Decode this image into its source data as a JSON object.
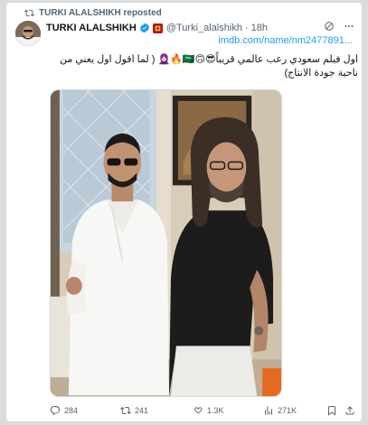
{
  "repost": {
    "label": "TURKI ALALSHIKH reposted"
  },
  "author": {
    "name": "TURKI ALALSHIKH",
    "handle": "@Turki_alalshikh",
    "separator": "·",
    "time": "18h"
  },
  "link": "imdb.com/name/nm2477891...",
  "tweet": {
    "text": "اول فيلم سعودي رعب عالمي قريباً😎🙃🇸🇦🔥🧕🏻 ( لما اقول اول يعني من ناحية جودة الانتاج)"
  },
  "actions": {
    "replies": "284",
    "reposts": "241",
    "likes": "1.3K",
    "views": "271K"
  },
  "colors": {
    "accent": "#1d9bf0",
    "muted": "#536471",
    "repost_green": "#00ba7c"
  },
  "icons": [
    "repost-icon",
    "verified-icon",
    "flag-badge-icon",
    "grok-icon",
    "more-icon",
    "reply-icon",
    "like-icon",
    "views-icon",
    "bookmark-icon",
    "share-icon"
  ]
}
